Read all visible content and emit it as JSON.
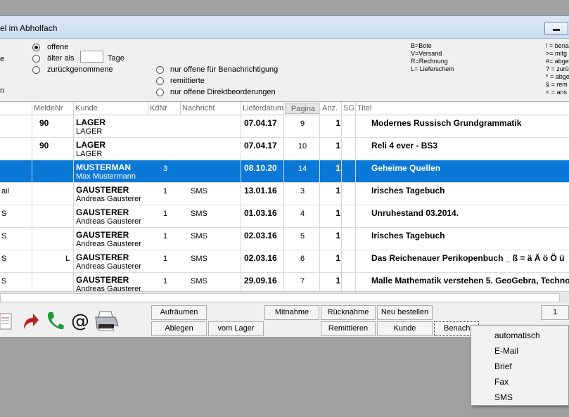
{
  "window": {
    "title": "el im Abholfach"
  },
  "filters": {
    "left_labels": [
      "e",
      "n"
    ],
    "status": [
      "offene",
      "älter als",
      "zurückgenommene"
    ],
    "tage_label": "Tage",
    "tage_value": "",
    "extra": [
      "nur offene für Benachrichtigung",
      "remittierte",
      "nur offene Direktbeorderungen"
    ]
  },
  "legend_codes": [
    "B=Bote",
    "V=Versand",
    "R=Rechnung",
    "L= Lieferschein"
  ],
  "legend_symbols": [
    "! = bena",
    ">= mitg",
    "#= abge",
    "? = zurü",
    "* = abge",
    "§ = rem",
    "< = ans"
  ],
  "columns": [
    "MeldeNr",
    "Kunde",
    "KdNr",
    "Nachricht",
    "Lieferdatum",
    "Pagina",
    "Anz.",
    "SG",
    "Titel"
  ],
  "rows": [
    {
      "pre": "",
      "melde": "90",
      "mark": "",
      "kunde": "LAGER",
      "kunde2": "LAGER",
      "kdnr": "",
      "nachricht": "",
      "datum": "07.04.17",
      "pagina": "9",
      "anz": "1",
      "titel": "Modernes Russisch Grundgrammatik"
    },
    {
      "pre": "",
      "melde": "90",
      "mark": "",
      "kunde": "LAGER",
      "kunde2": "LAGER",
      "kdnr": "",
      "nachricht": "",
      "datum": "07.04.17",
      "pagina": "10",
      "anz": "1",
      "titel": "Reli 4 ever - BS3"
    },
    {
      "pre": "",
      "melde": "",
      "mark": "",
      "kunde": "MUSTERMAN",
      "kunde2": "Max Mustermann",
      "kdnr": "3",
      "nachricht": "",
      "datum": "08.10.20",
      "pagina": "14",
      "anz": "1",
      "titel": "Geheime Quellen",
      "selected": true
    },
    {
      "pre": "ail",
      "melde": "",
      "mark": "",
      "kunde": "GAUSTERER",
      "kunde2": "Andreas Gausterer",
      "kdnr": "1",
      "nachricht": "SMS",
      "datum": "13.01.16",
      "pagina": "3",
      "anz": "1",
      "titel": "Irisches Tagebuch"
    },
    {
      "pre": "S",
      "melde": "",
      "mark": "",
      "kunde": "GAUSTERER",
      "kunde2": "Andreas Gausterer",
      "kdnr": "1",
      "nachricht": "SMS",
      "datum": "01.03.16",
      "pagina": "4",
      "anz": "1",
      "titel": "Unruhestand 03.2014."
    },
    {
      "pre": "S",
      "melde": "",
      "mark": "",
      "kunde": "GAUSTERER",
      "kunde2": "Andreas Gausterer",
      "kdnr": "1",
      "nachricht": "SMS",
      "datum": "02.03.16",
      "pagina": "5",
      "anz": "1",
      "titel": "Irisches Tagebuch"
    },
    {
      "pre": "S",
      "melde": "",
      "mark": "L",
      "kunde": "GAUSTERER",
      "kunde2": "Andreas Gausterer",
      "kdnr": "1",
      "nachricht": "SMS",
      "datum": "02.03.16",
      "pagina": "6",
      "anz": "1",
      "titel": "Das Reichenauer Perikopenbuch _ ß = ä Ä ö Ö ü"
    },
    {
      "pre": "S",
      "melde": "",
      "mark": "",
      "kunde": "GAUSTERER",
      "kunde2": "Andreas Gausterer",
      "kdnr": "1",
      "nachricht": "SMS",
      "datum": "29.09.16",
      "pagina": "7",
      "anz": "1",
      "titel": "Malle Mathematik verstehen 5. GeoGebra, Techno"
    }
  ],
  "buttons": {
    "aufraeumen": "Aufräumen",
    "ablegen": "Ablegen",
    "vom_lager": "vom Lager",
    "mitnahme": "Mitnahme",
    "ruecknahme": "Rücknahme",
    "neu_bestellen": "Neu bestellen",
    "remittieren": "Remittieren",
    "kunde": "Kunde",
    "benach": "Benach",
    "right": "1"
  },
  "menu": [
    "automatisch",
    "E-Mail",
    "Brief",
    "Fax",
    "SMS"
  ],
  "colors": {
    "selection": "#0a78d7",
    "titlebar": "#d3e3f2",
    "phone": "#1a9a3a",
    "arrow": "#c0201a"
  }
}
